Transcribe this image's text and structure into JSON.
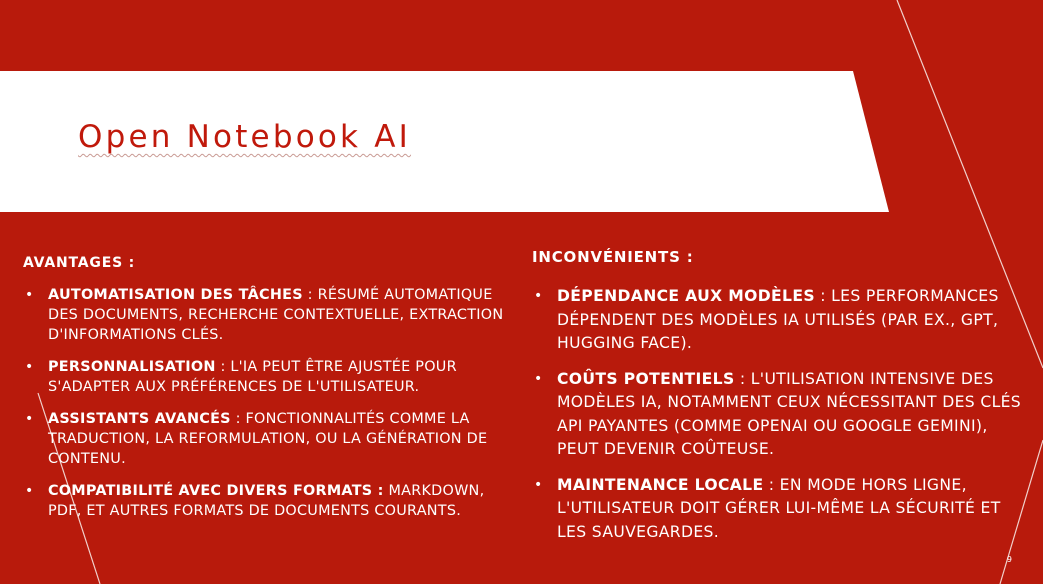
{
  "slide": {
    "title": "Open Notebook AI",
    "page_number": "9",
    "colors": {
      "background": "#b81a0c",
      "title_band": "#ffffff",
      "title_text": "#c0190b",
      "body_text": "#ffffff"
    }
  },
  "advantages": {
    "heading": "AVANTAGES :",
    "items": [
      {
        "term": "Automatisation des tâches",
        "text": " : résumé automatique des documents, recherche contextuelle, extraction d'informations clés."
      },
      {
        "term": "Personnalisation",
        "text": " : L'IA peut être ajustée pour s'adapter aux préférences de l'utilisateur."
      },
      {
        "term": "Assistants avancés",
        "text": " : Fonctionnalités comme la traduction, la reformulation, ou la génération de contenu."
      },
      {
        "term": "Compatibilité avec divers formats :",
        "text": " Markdown, PDF, et autres formats de documents courants."
      }
    ]
  },
  "disadvantages": {
    "heading": "INCONVÉNIENTS :",
    "items": [
      {
        "term": "Dépendance aux modèles",
        "text": " : Les performances dépendent des modèles IA utilisés (par ex., GPT, Hugging Face)."
      },
      {
        "term": "Coûts potentiels",
        "text": " : L'utilisation intensive des modèles IA, notamment ceux nécessitant des clés API payantes (comme OpenAI ou Google Gemini), peut devenir coûteuse."
      },
      {
        "term": "Maintenance locale",
        "text": " : En mode hors ligne, l'utilisateur doit gérer lui-même la sécurité et les sauvegardes."
      }
    ]
  }
}
